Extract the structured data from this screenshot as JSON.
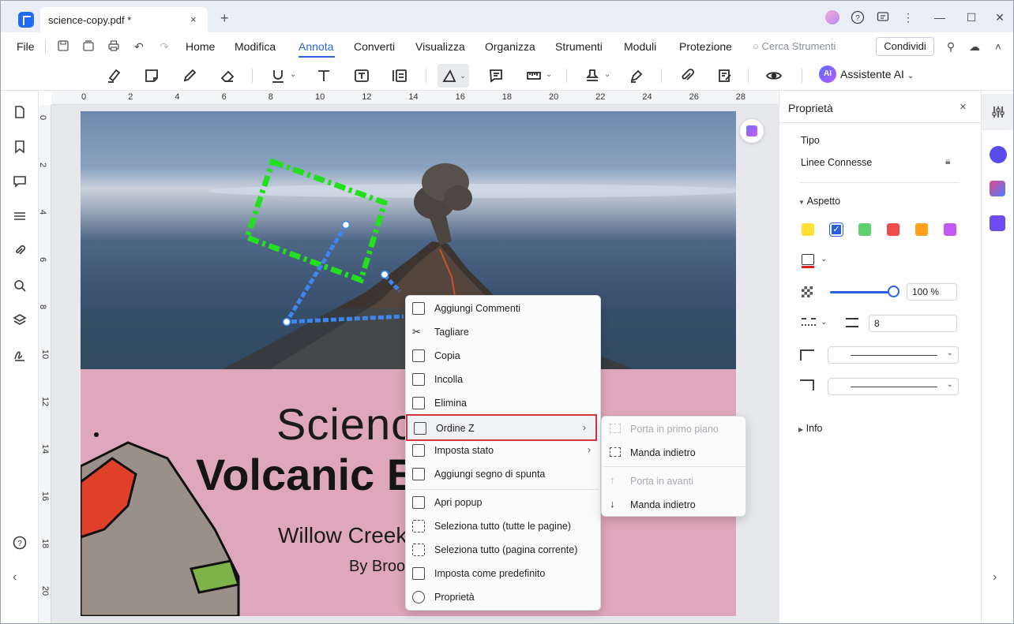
{
  "window": {
    "tab_title": "science-copy.pdf *",
    "tab_close": "×",
    "new_tab": "+"
  },
  "menubar": {
    "file": "File",
    "items": [
      "Home",
      "Modifica",
      "Annota",
      "Converti",
      "Visualizza",
      "Organizza",
      "Strumenti",
      "Moduli",
      "Protezione"
    ],
    "active": "Annota",
    "search_placeholder": "Cerca Strumenti",
    "share": "Condividi"
  },
  "toolbar": {
    "ai_badge": "AI",
    "ai_label": "Assistente AI"
  },
  "rulers": {
    "h": [
      "0",
      "2",
      "4",
      "6",
      "8",
      "10",
      "12",
      "14",
      "16",
      "18",
      "20",
      "22",
      "24",
      "26",
      "28"
    ],
    "v": [
      "0",
      "2",
      "4",
      "6",
      "8",
      "10",
      "12",
      "14",
      "16",
      "18",
      "20"
    ]
  },
  "document": {
    "title1": "Scienc",
    "title2": "Volcanic E",
    "title3": "Willow Creek",
    "title4": "By Broo"
  },
  "context_menu": {
    "items": [
      {
        "label": "Aggiungi Commenti"
      },
      {
        "label": "Tagliare"
      },
      {
        "label": "Copia"
      },
      {
        "label": "Incolla"
      },
      {
        "label": "Elimina"
      },
      {
        "label": "Ordine Z",
        "arrow": "›"
      },
      {
        "label": "Imposta stato",
        "arrow": "›"
      },
      {
        "label": "Aggiungi segno di spunta"
      },
      {
        "label": "Apri popup"
      },
      {
        "label": "Seleziona tutto (tutte le pagine)"
      },
      {
        "label": "Seleziona tutto (pagina corrente)"
      },
      {
        "label": "Imposta come predefinito"
      },
      {
        "label": "Proprietà"
      }
    ],
    "submenu": [
      {
        "label": "Porta in primo piano",
        "disabled": true
      },
      {
        "label": "Manda indietro",
        "disabled": false
      },
      {
        "label": "Porta in avanti",
        "disabled": true
      },
      {
        "label": "Manda indietro",
        "disabled": false
      }
    ]
  },
  "properties": {
    "title": "Proprietà",
    "close": "×",
    "tipo_label": "Tipo",
    "tipo_value": "Linee Connesse",
    "aspetto": "Aspetto",
    "colors": [
      "#ffe033",
      "#2a5fe6",
      "#5fd16a",
      "#f04b4b",
      "#ff9f1a",
      "#c358f2"
    ],
    "selected_color": "#2a5fe6",
    "opacity": "100 %",
    "opacity_value": 100,
    "thickness": "8",
    "info": "Info"
  }
}
